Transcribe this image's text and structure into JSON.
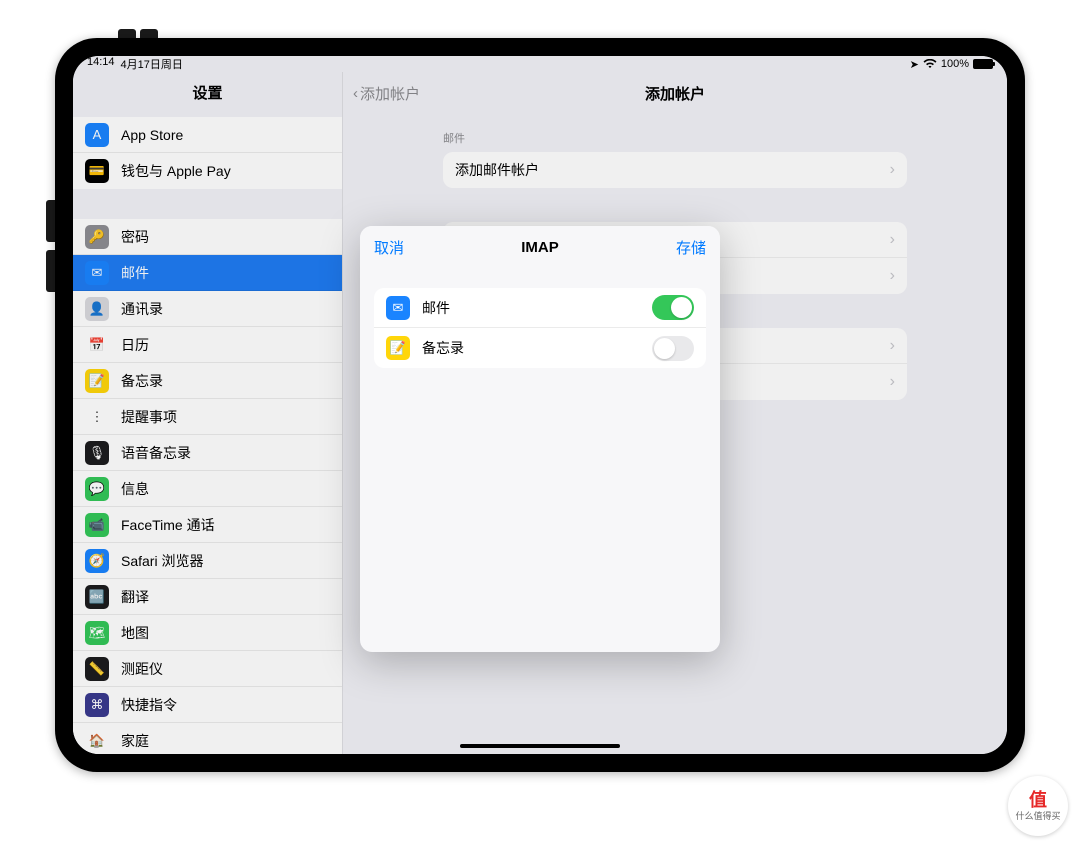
{
  "status": {
    "time": "14:14",
    "date": "4月17日周日",
    "battery_pct": "100%",
    "location_icon": "▴",
    "wifi_icon": "✓"
  },
  "sidebar": {
    "title": "设置",
    "group1": [
      {
        "label": "App Store",
        "icon_bg": "#1a84ff",
        "icon_glyph": "A"
      },
      {
        "label": "钱包与 Apple Pay",
        "icon_bg": "#000",
        "icon_glyph": "💳"
      }
    ],
    "group2": [
      {
        "label": "密码",
        "icon_bg": "#8e8e93",
        "icon_glyph": "🔑"
      },
      {
        "label": "邮件",
        "icon_bg": "#1a84ff",
        "icon_glyph": "✉",
        "selected": true
      },
      {
        "label": "通讯录",
        "icon_bg": "#d9d9de",
        "icon_glyph": "👤"
      },
      {
        "label": "日历",
        "icon_bg": "#fff",
        "icon_glyph": "📅"
      },
      {
        "label": "备忘录",
        "icon_bg": "#ffd60a",
        "icon_glyph": "📝"
      },
      {
        "label": "提醒事项",
        "icon_bg": "#fff",
        "icon_glyph": "⋮"
      },
      {
        "label": "语音备忘录",
        "icon_bg": "#1c1c1e",
        "icon_glyph": "🎙"
      },
      {
        "label": "信息",
        "icon_bg": "#34c759",
        "icon_glyph": "💬"
      },
      {
        "label": "FaceTime 通话",
        "icon_bg": "#34c759",
        "icon_glyph": "📹"
      },
      {
        "label": "Safari 浏览器",
        "icon_bg": "#1a84ff",
        "icon_glyph": "🧭"
      },
      {
        "label": "翻译",
        "icon_bg": "#1c1c1e",
        "icon_glyph": "🔤"
      },
      {
        "label": "地图",
        "icon_bg": "#34c759",
        "icon_glyph": "🗺"
      },
      {
        "label": "测距仪",
        "icon_bg": "#1c1c1e",
        "icon_glyph": "📏"
      },
      {
        "label": "快捷指令",
        "icon_bg": "#3a3a8f",
        "icon_glyph": "⌘"
      },
      {
        "label": "家庭",
        "icon_bg": "#fff",
        "icon_glyph": "🏠"
      }
    ]
  },
  "content": {
    "back_label": "添加帐户",
    "title": "添加帐户",
    "section_mail_label": "邮件",
    "row_add_mail": "添加邮件帐户"
  },
  "modal": {
    "cancel": "取消",
    "title": "IMAP",
    "save": "存储",
    "items": [
      {
        "label": "邮件",
        "icon_bg": "#1a84ff",
        "icon_glyph": "✉",
        "on": true
      },
      {
        "label": "备忘录",
        "icon_bg": "#ffd60a",
        "icon_glyph": "📝",
        "on": false
      }
    ]
  },
  "watermark": {
    "char": "值",
    "text": "什么值得买"
  }
}
